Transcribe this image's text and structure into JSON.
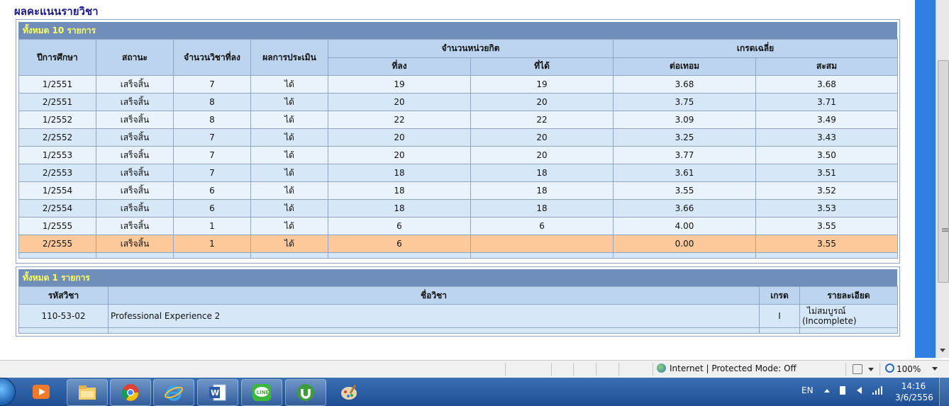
{
  "page_title": "ผลคะแนนรายวิชา",
  "summary_table": {
    "count_label": "ทั้งหมด   10  รายการ",
    "headers": {
      "term": "ปีการศึกษา",
      "status": "สถานะ",
      "courses": "จำนวนวิชาที่ลง",
      "result": "ผลการประเมิน",
      "credits": "จำนวนหน่วยกิต",
      "credits_registered": "ที่ลง",
      "credits_earned": "ที่ได้",
      "gpa": "เกรดเฉลี่ย",
      "gpa_term": "ต่อเทอม",
      "gpa_cumulative": "สะสม"
    },
    "rows": [
      {
        "term": "1/2551",
        "status": "เสร็จสิ้น",
        "courses": "7",
        "result": "ได้",
        "reg": "19",
        "earned": "19",
        "gpa": "3.68",
        "gpax": "3.68"
      },
      {
        "term": "2/2551",
        "status": "เสร็จสิ้น",
        "courses": "8",
        "result": "ได้",
        "reg": "20",
        "earned": "20",
        "gpa": "3.75",
        "gpax": "3.71"
      },
      {
        "term": "1/2552",
        "status": "เสร็จสิ้น",
        "courses": "8",
        "result": "ได้",
        "reg": "22",
        "earned": "22",
        "gpa": "3.09",
        "gpax": "3.49"
      },
      {
        "term": "2/2552",
        "status": "เสร็จสิ้น",
        "courses": "7",
        "result": "ได้",
        "reg": "20",
        "earned": "20",
        "gpa": "3.25",
        "gpax": "3.43"
      },
      {
        "term": "1/2553",
        "status": "เสร็จสิ้น",
        "courses": "7",
        "result": "ได้",
        "reg": "20",
        "earned": "20",
        "gpa": "3.77",
        "gpax": "3.50"
      },
      {
        "term": "2/2553",
        "status": "เสร็จสิ้น",
        "courses": "7",
        "result": "ได้",
        "reg": "18",
        "earned": "18",
        "gpa": "3.61",
        "gpax": "3.51"
      },
      {
        "term": "1/2554",
        "status": "เสร็จสิ้น",
        "courses": "6",
        "result": "ได้",
        "reg": "18",
        "earned": "18",
        "gpa": "3.55",
        "gpax": "3.52"
      },
      {
        "term": "2/2554",
        "status": "เสร็จสิ้น",
        "courses": "6",
        "result": "ได้",
        "reg": "18",
        "earned": "18",
        "gpa": "3.66",
        "gpax": "3.53"
      },
      {
        "term": "1/2555",
        "status": "เสร็จสิ้น",
        "courses": "1",
        "result": "ได้",
        "reg": "6",
        "earned": "6",
        "gpa": "4.00",
        "gpax": "3.55"
      },
      {
        "term": "2/2555",
        "status": "เสร็จสิ้น",
        "courses": "1",
        "result": "ได้",
        "reg": "6",
        "earned": "",
        "gpa": "0.00",
        "gpax": "3.55"
      }
    ]
  },
  "detail_table": {
    "count_label": "ทั้งหมด  1  รายการ",
    "headers": {
      "code": "รหัสวิชา",
      "name": "ชื่อวิชา",
      "grade": "เกรด",
      "detail": "รายละเอียด"
    },
    "rows": [
      {
        "code": "110-53-02",
        "name": "Professional Experience 2",
        "grade": "I",
        "detail_1": "ไม่สมบูรณ์",
        "detail_2": "(Incomplete)"
      }
    ]
  },
  "statusbar": {
    "zone": "Internet | Protected Mode: Off",
    "zoom": "100%"
  },
  "taskbar": {
    "lang": "EN",
    "time": "14:16",
    "date": "3/6/2556",
    "icons": [
      "media-player-icon",
      "file-explorer-icon",
      "chrome-icon",
      "internet-explorer-icon",
      "word-icon",
      "line-icon",
      "utorrent-icon",
      "paint-icon"
    ]
  },
  "colors": {
    "bar": "#6f8fba",
    "bar_text": "#ffff66",
    "header": "#bcd4ee",
    "row_odd": "#eaf3fc",
    "row_even": "#d6e7f8",
    "row_selected": "#fdc99a"
  }
}
